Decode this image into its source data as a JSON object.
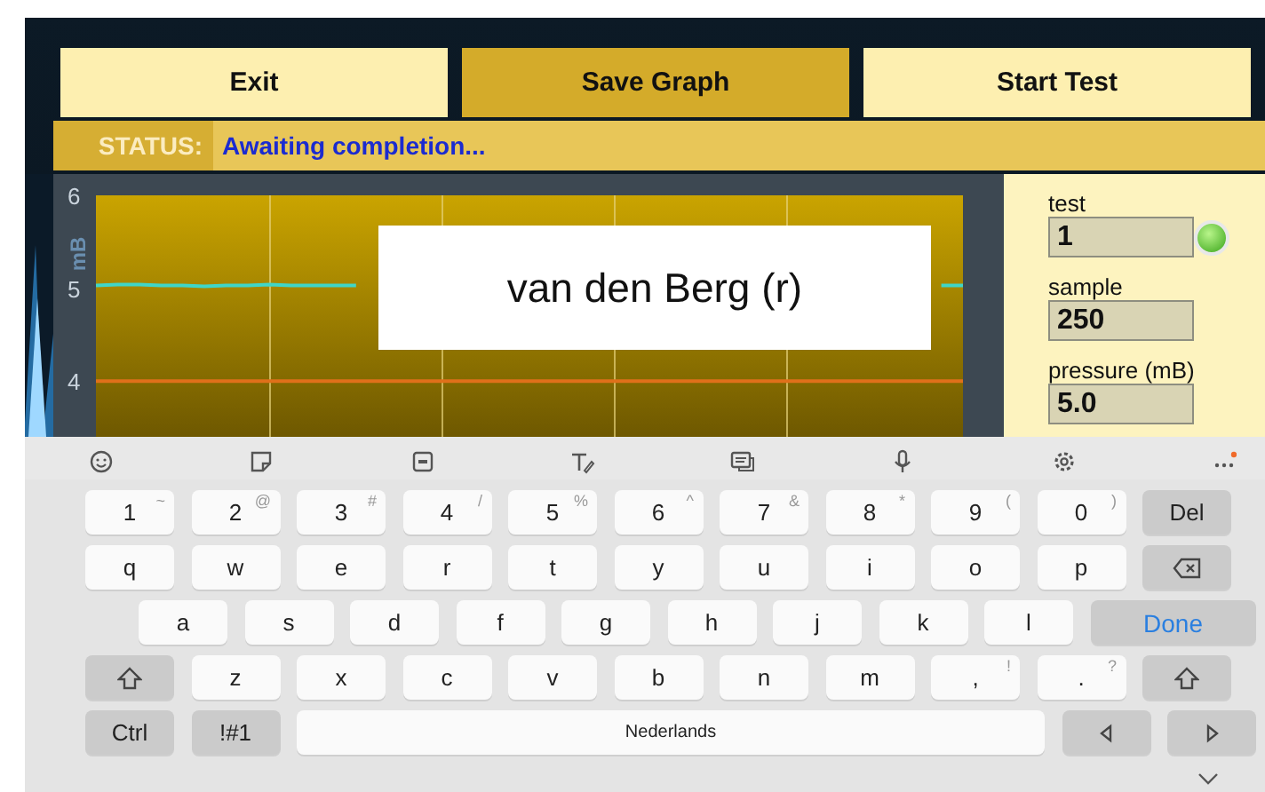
{
  "buttons": [
    {
      "label": "Exit",
      "selected": false
    },
    {
      "label": "Save Graph",
      "selected": true
    },
    {
      "label": "Start Test",
      "selected": false
    }
  ],
  "status": {
    "label": "STATUS:",
    "text": "Awaiting completion..."
  },
  "graph": {
    "chart_data": {
      "type": "line",
      "ylabel": "mB",
      "yticks": [
        4,
        5,
        6
      ],
      "ylim": [
        3.4,
        6
      ],
      "grid": true,
      "categories": [
        null,
        null,
        null,
        null,
        null,
        null,
        null,
        null,
        null,
        null,
        null,
        null,
        null,
        null,
        null,
        null,
        null,
        null,
        null,
        null,
        null,
        null,
        null,
        null,
        null,
        null,
        null,
        null,
        null,
        null,
        null,
        null,
        null,
        null,
        null,
        null,
        null,
        null,
        null,
        null,
        null
      ],
      "series": [
        {
          "color": "#3fd6c8",
          "values": [
            5.03,
            5.04,
            5.04,
            5.03,
            5.03,
            5.02,
            5.03,
            5.03,
            5.04,
            5.03,
            5.03,
            5.03,
            5.03,
            null,
            null,
            null,
            null,
            null,
            null,
            null,
            null,
            null,
            null,
            null,
            null,
            null,
            null,
            null,
            null,
            null,
            null,
            null,
            null,
            null,
            null,
            null,
            null,
            null,
            null,
            5.03,
            5.03
          ]
        },
        {
          "color": "#e0701a",
          "values": [
            4,
            4,
            4,
            4,
            4,
            4,
            4,
            4,
            4,
            4,
            4,
            4,
            4,
            4,
            4,
            4,
            4,
            4,
            4,
            4,
            4,
            4,
            4,
            4,
            4,
            4,
            4,
            4,
            4,
            4,
            4,
            4,
            4,
            4,
            4,
            4,
            4,
            4,
            4,
            4,
            4
          ]
        }
      ]
    },
    "popup": "van den Berg (r)"
  },
  "fields": [
    {
      "label": "test",
      "value": "1",
      "kind": "toggle",
      "on": true
    },
    {
      "label": "sample",
      "value": "250",
      "kind": "plain"
    },
    {
      "label": "pressure (mB)",
      "value": "5.0",
      "kind": "plain"
    }
  ],
  "keyboard": {
    "rows": [
      {
        "indent": false,
        "keys": [
          {
            "kind": "char",
            "label": "1",
            "hint": "~"
          },
          {
            "kind": "char",
            "label": "2",
            "hint": "@"
          },
          {
            "kind": "char",
            "label": "3",
            "hint": "#"
          },
          {
            "kind": "char",
            "label": "4",
            "hint": "/"
          },
          {
            "kind": "char",
            "label": "5",
            "hint": "%"
          },
          {
            "kind": "char",
            "label": "6",
            "hint": "^"
          },
          {
            "kind": "char",
            "label": "7",
            "hint": "&"
          },
          {
            "kind": "char",
            "label": "8",
            "hint": "*"
          },
          {
            "kind": "char",
            "label": "9",
            "hint": "("
          },
          {
            "kind": "char",
            "label": "0",
            "hint": ")"
          },
          {
            "kind": "func",
            "label": "Del"
          }
        ]
      },
      {
        "indent": false,
        "keys": [
          {
            "kind": "char",
            "label": "q"
          },
          {
            "kind": "char",
            "label": "w"
          },
          {
            "kind": "char",
            "label": "e"
          },
          {
            "kind": "char",
            "label": "r"
          },
          {
            "kind": "char",
            "label": "t"
          },
          {
            "kind": "char",
            "label": "y"
          },
          {
            "kind": "char",
            "label": "u"
          },
          {
            "kind": "char",
            "label": "i"
          },
          {
            "kind": "char",
            "label": "o"
          },
          {
            "kind": "char",
            "label": "p"
          },
          {
            "kind": "backspace"
          }
        ]
      },
      {
        "indent": true,
        "keys": [
          {
            "kind": "char",
            "label": "a"
          },
          {
            "kind": "char",
            "label": "s"
          },
          {
            "kind": "char",
            "label": "d"
          },
          {
            "kind": "char",
            "label": "f"
          },
          {
            "kind": "char",
            "label": "g"
          },
          {
            "kind": "char",
            "label": "h"
          },
          {
            "kind": "char",
            "label": "j"
          },
          {
            "kind": "char",
            "label": "k"
          },
          {
            "kind": "char",
            "label": "l"
          },
          {
            "kind": "action",
            "label": "Done"
          }
        ]
      },
      {
        "indent": false,
        "keys": [
          {
            "kind": "shift"
          },
          {
            "kind": "char",
            "label": "z"
          },
          {
            "kind": "char",
            "label": "x"
          },
          {
            "kind": "char",
            "label": "c"
          },
          {
            "kind": "char",
            "label": "v"
          },
          {
            "kind": "char",
            "label": "b"
          },
          {
            "kind": "char",
            "label": "n"
          },
          {
            "kind": "char",
            "label": "m"
          },
          {
            "kind": "char",
            "label": ",",
            "hint": "!"
          },
          {
            "kind": "char",
            "label": ".",
            "hint": "?"
          },
          {
            "kind": "shift"
          }
        ]
      },
      {
        "indent": false,
        "keys": [
          {
            "kind": "func",
            "label": "Ctrl"
          },
          {
            "kind": "func",
            "label": "!#1"
          },
          {
            "kind": "space",
            "label": "Nederlands"
          },
          {
            "kind": "left"
          },
          {
            "kind": "right"
          }
        ]
      }
    ]
  }
}
